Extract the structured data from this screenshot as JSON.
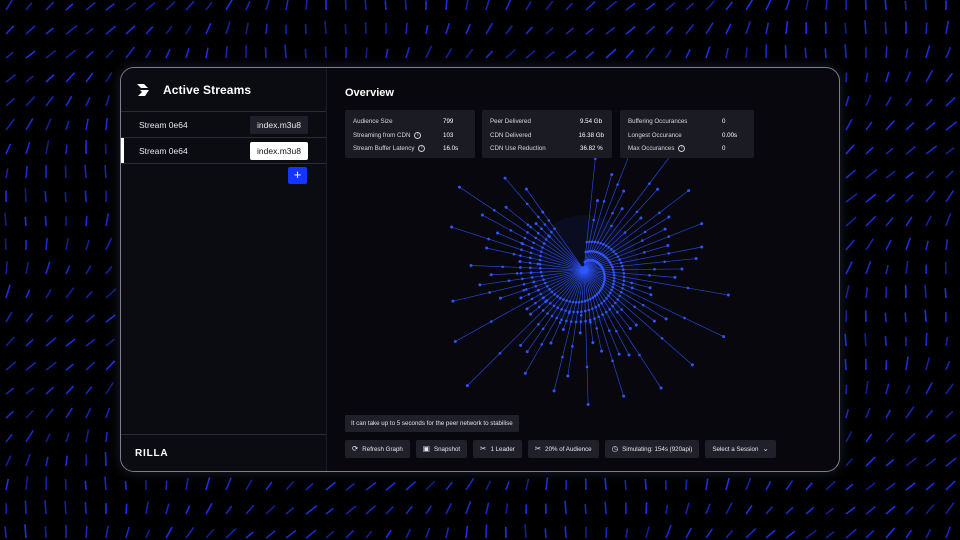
{
  "sidebar": {
    "title": "Active Streams",
    "brand": "RILLA",
    "streams": [
      {
        "name": "Stream 0e64",
        "file": "index.m3u8"
      },
      {
        "name": "Stream 0e64",
        "file": "index.m3u8"
      }
    ],
    "add_label": "+"
  },
  "main": {
    "title": "Overview",
    "stats": [
      [
        {
          "label": "Audience Size",
          "value": "799",
          "info": false
        },
        {
          "label": "Streaming from CDN",
          "value": "103",
          "info": true
        },
        {
          "label": "Stream Buffer Latency",
          "value": "16.0s",
          "info": true
        }
      ],
      [
        {
          "label": "Peer Delivered",
          "value": "9.54 Gb",
          "info": false
        },
        {
          "label": "CDN Delivered",
          "value": "16.38 Gb",
          "info": false
        },
        {
          "label": "CDN Use Reduction",
          "value": "36.82 %",
          "info": false
        }
      ],
      [
        {
          "label": "Buffering Occurances",
          "value": "0",
          "info": false
        },
        {
          "label": "Longest Occurance",
          "value": "0.00s",
          "info": false
        },
        {
          "label": "Max Occurances",
          "value": "0",
          "info": true
        }
      ]
    ],
    "notice": "It can take up to 5 seconds for the peer network to stabilise",
    "toolbar": [
      {
        "icon": "refresh-icon",
        "glyph": "⟳",
        "label": "Refresh Graph"
      },
      {
        "icon": "camera-icon",
        "glyph": "▣",
        "label": "Snapshot"
      },
      {
        "icon": "scissors-icon",
        "glyph": "✂",
        "label": "1 Leader"
      },
      {
        "icon": "scissors-icon",
        "glyph": "✂",
        "label": "20% of Audience"
      },
      {
        "icon": "clock-icon",
        "glyph": "◷",
        "label": "Simulating: 154s (920api)"
      },
      {
        "icon": "chevron-down-icon",
        "glyph": "⌄",
        "label": "Select a Session"
      }
    ]
  },
  "colors": {
    "accent": "#1236ff",
    "graph": "#2f55ff",
    "background_dash": "#2233ff"
  }
}
